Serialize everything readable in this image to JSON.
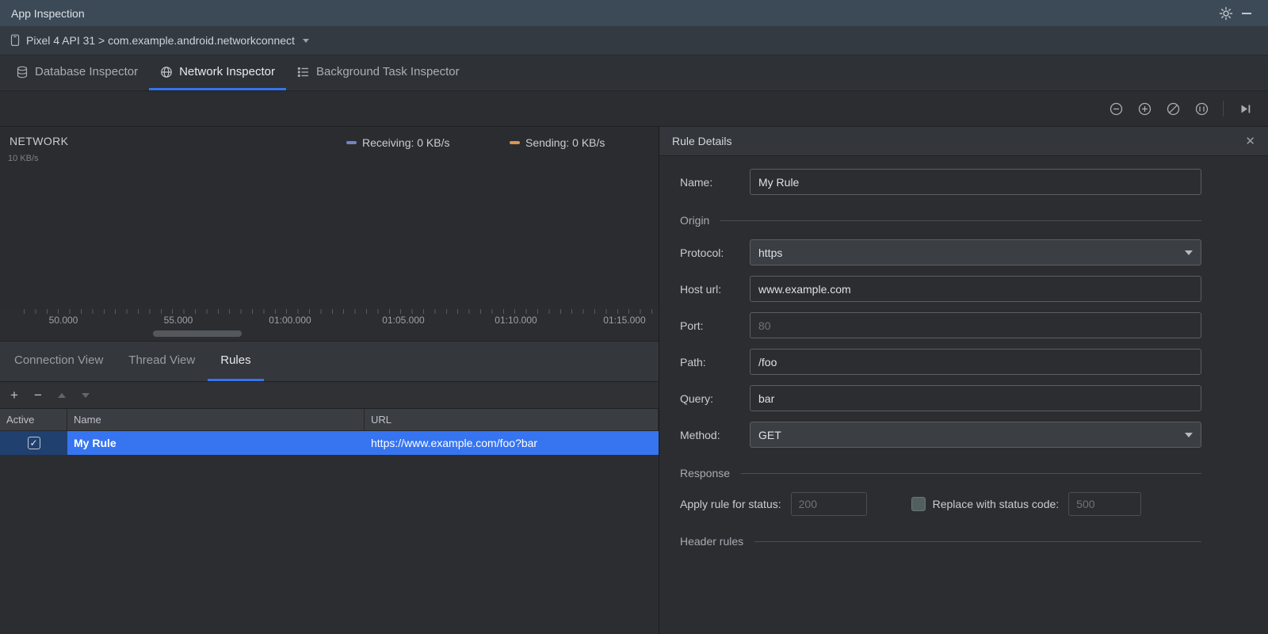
{
  "titlebar": {
    "title": "App Inspection"
  },
  "processbar": {
    "device": "Pixel 4 API 31 > com.example.android.networkconnect"
  },
  "inspector_tabs": [
    {
      "label": "Database Inspector",
      "selected": false
    },
    {
      "label": "Network Inspector",
      "selected": true
    },
    {
      "label": "Background Task Inspector",
      "selected": false
    }
  ],
  "timeline": {
    "title": "NETWORK",
    "y_max_label": "10 KB/s",
    "legend": [
      {
        "label": "Receiving: 0 KB/s",
        "color": "#6D87C4"
      },
      {
        "label": "Sending: 0 KB/s",
        "color": "#D99550"
      }
    ],
    "ticks": [
      "50.000",
      "55.000",
      "01:00.000",
      "01:05.000",
      "01:10.000",
      "01:15.000"
    ]
  },
  "view_tabs": [
    {
      "label": "Connection View",
      "selected": false
    },
    {
      "label": "Thread View",
      "selected": false
    },
    {
      "label": "Rules",
      "selected": true
    }
  ],
  "rules_table": {
    "columns": [
      "Active",
      "Name",
      "URL"
    ],
    "rows": [
      {
        "active": true,
        "check": "✓",
        "name": "My Rule",
        "url": "https://www.example.com/foo?bar"
      }
    ]
  },
  "rule_details": {
    "title": "Rule Details",
    "name": {
      "label": "Name:",
      "value": "My Rule"
    },
    "origin": {
      "section": "Origin",
      "protocol": {
        "label": "Protocol:",
        "value": "https"
      },
      "host": {
        "label": "Host url:",
        "value": "www.example.com"
      },
      "port": {
        "label": "Port:",
        "placeholder": "80"
      },
      "path": {
        "label": "Path:",
        "value": "/foo"
      },
      "query": {
        "label": "Query:",
        "value": "bar"
      },
      "method": {
        "label": "Method:",
        "value": "GET"
      }
    },
    "response": {
      "section": "Response",
      "apply_label": "Apply rule for status:",
      "apply_placeholder": "200",
      "replace_label": "Replace with status code:",
      "replace_placeholder": "500"
    },
    "header_rules": {
      "section": "Header rules"
    }
  },
  "colors": {
    "accent": "#3674F0",
    "selection": "#3674F0",
    "titlebar": "#3C4A57"
  }
}
